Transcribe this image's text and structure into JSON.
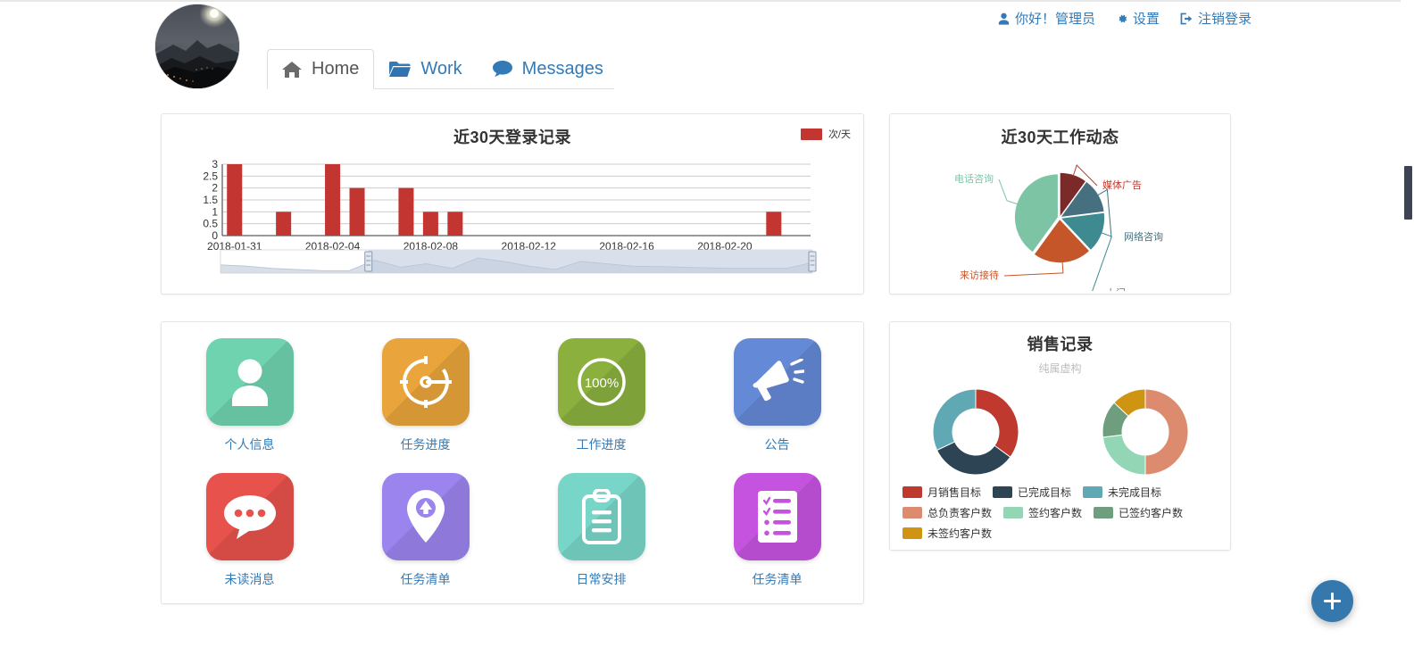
{
  "usernav": {
    "greeting": "你好！管理员",
    "settings": "设置",
    "logout": "注销登录",
    "greeting_icon": "user-icon",
    "settings_icon": "gear-icon",
    "logout_icon": "sign-out-icon"
  },
  "avatar": {
    "name": "user-avatar",
    "description": "mountain landscape photo"
  },
  "tabs": [
    {
      "label": "Home",
      "icon": "home-icon",
      "active": true
    },
    {
      "label": "Work",
      "icon": "folder-icon",
      "active": false
    },
    {
      "label": "Messages",
      "icon": "comment-icon",
      "active": false
    }
  ],
  "panels": {
    "login": {
      "title": "近30天登录记录",
      "legend": "次/天"
    },
    "work": {
      "title": "近30天工作动态"
    },
    "sales": {
      "title": "销售记录",
      "subtitle": "纯属虚构"
    }
  },
  "tiles": [
    {
      "label": "个人信息",
      "icon": "person-icon",
      "color": "#6FD3B0"
    },
    {
      "label": "任务进度",
      "icon": "gauge-icon",
      "color": "#E9A53B"
    },
    {
      "label": "工作进度",
      "icon": "percent-ring-icon",
      "color": "#8BB03E",
      "value": "100%"
    },
    {
      "label": "公告",
      "icon": "megaphone-icon",
      "color": "#6489D6"
    },
    {
      "label": "未读消息",
      "icon": "speech-bubble-icon",
      "color": "#E8524C"
    },
    {
      "label": "任务清单",
      "icon": "map-pin-icon",
      "color": "#9B84EE"
    },
    {
      "label": "日常安排",
      "icon": "clipboard-icon",
      "color": "#77D6C8"
    },
    {
      "label": "任务清单",
      "icon": "checklist-icon",
      "color": "#C653E0"
    }
  ],
  "sales_legend": [
    {
      "label": "月销售目标",
      "color": "#C0392E"
    },
    {
      "label": "已完成目标",
      "color": "#2C4454"
    },
    {
      "label": "未完成目标",
      "color": "#61A8B5"
    },
    {
      "label": "总负责客户数",
      "color": "#DD8B6F"
    },
    {
      "label": "签约客户数",
      "color": "#92D6B5"
    },
    {
      "label": "已签约客户数",
      "color": "#6E9E7E"
    },
    {
      "label": "未签约客户数",
      "color": "#CE9412"
    }
  ],
  "fab": {
    "label": "+",
    "icon": "plus-icon"
  },
  "chart_data": [
    {
      "type": "bar",
      "title": "近30天登录记录",
      "legend": [
        "次/天"
      ],
      "xlabel": "",
      "ylabel": "",
      "ylim": [
        0,
        3
      ],
      "yticks": [
        0,
        0.5,
        1,
        1.5,
        2,
        2.5,
        3
      ],
      "tick_labels": [
        "2018-01-31",
        "2018-02-04",
        "2018-02-08",
        "2018-02-12",
        "2018-02-16",
        "2018-02-20"
      ],
      "categories": [
        "2018-01-31",
        "2018-02-01",
        "2018-02-02",
        "2018-02-03",
        "2018-02-04",
        "2018-02-05",
        "2018-02-06",
        "2018-02-07",
        "2018-02-08",
        "2018-02-09",
        "2018-02-10",
        "2018-02-11",
        "2018-02-12",
        "2018-02-13",
        "2018-02-14",
        "2018-02-15",
        "2018-02-16",
        "2018-02-17",
        "2018-02-18",
        "2018-02-19",
        "2018-02-20",
        "2018-02-21",
        "2018-02-22",
        "2018-02-23"
      ],
      "values": [
        3,
        0,
        1,
        0,
        3,
        2,
        0,
        2,
        1,
        1,
        0,
        0,
        0,
        0,
        0,
        0,
        0,
        0,
        0,
        0,
        0,
        0,
        1,
        0
      ],
      "color": "#C23531",
      "grid": true,
      "has_datazoom": true,
      "datazoom_start_pct": 25,
      "datazoom_end_pct": 100
    },
    {
      "type": "pie",
      "title": "近30天工作动态",
      "labels": [
        "媒体广告",
        "网络咨询",
        "上门",
        "来访接待",
        "电话咨询"
      ],
      "values": [
        10,
        13,
        15,
        22,
        40
      ],
      "colors": [
        "#7B2A2A",
        "#46707F",
        "#3E8A91",
        "#C4562A",
        "#7DC4A5"
      ],
      "label_colors": [
        "#C0392E",
        "#46707F",
        "#3E8A91",
        "#C4562A",
        "#7DC4A5"
      ],
      "legend_position": "callout-labels"
    },
    {
      "type": "pie",
      "title": "销售记录",
      "subtitle": "纯属虚构",
      "name": "目标完成情况",
      "labels": [
        "月销售目标",
        "已完成目标",
        "未完成目标"
      ],
      "values": [
        35,
        33,
        32
      ],
      "colors": [
        "#C0392E",
        "#2C4454",
        "#61A8B5"
      ],
      "donut": true
    },
    {
      "type": "pie",
      "title": "销售记录",
      "name": "客户数情况",
      "labels": [
        "总负责客户数",
        "签约客户数",
        "已签约客户数",
        "未签约客户数"
      ],
      "values": [
        50,
        23,
        14,
        13
      ],
      "colors": [
        "#DD8B6F",
        "#92D6B5",
        "#6E9E7E",
        "#CE9412"
      ],
      "donut": true
    }
  ]
}
